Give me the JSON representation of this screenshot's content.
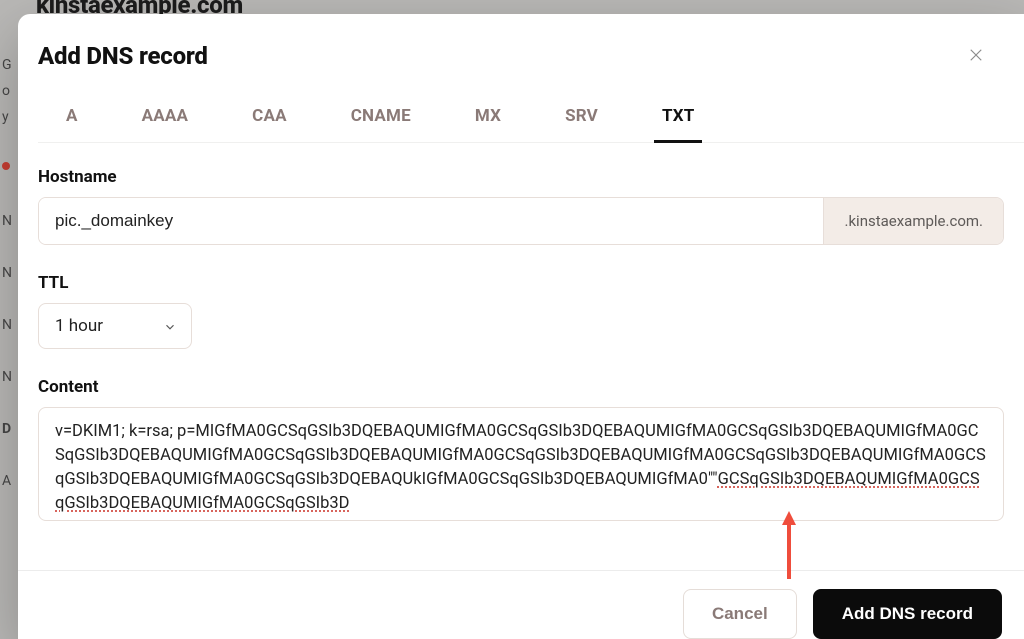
{
  "underlying": {
    "domain_text": "kinstaexample.com",
    "left_gutter": [
      "G",
      "o",
      "y",
      " ",
      "●",
      " ",
      "N",
      " ",
      "N",
      " ",
      "N",
      " ",
      "N",
      " ",
      "D",
      " ",
      "A"
    ]
  },
  "modal": {
    "title": "Add DNS record",
    "close_icon": "close-icon"
  },
  "tabs": [
    {
      "label": "A",
      "active": false
    },
    {
      "label": "AAAA",
      "active": false
    },
    {
      "label": "CAA",
      "active": false
    },
    {
      "label": "CNAME",
      "active": false
    },
    {
      "label": "MX",
      "active": false
    },
    {
      "label": "SRV",
      "active": false
    },
    {
      "label": "TXT",
      "active": true
    }
  ],
  "hostname": {
    "label": "Hostname",
    "value": "pic._domainkey",
    "suffix": ".kinstaexample.com."
  },
  "ttl": {
    "label": "TTL",
    "selected": "1 hour"
  },
  "content": {
    "label": "Content",
    "value_head": "v=DKIM1; k=rsa; p=MIGfMA0GCSqGSIb3DQEBAQUMIGfMA0GCSqGSIb3DQEBAQUMIGfMA0GCSqGSIb3DQEBAQUMIGfMA0GCSqGSIb3DQEBAQUMIGfMA0GCSqGSIb3DQEBAQUMIGfMA0GCSqGSIb3DQEBAQUMIGfMA0GCSqGSIb3DQEBAQUMIGfMA0GCSqGSIb3DQEBAQUMIGfMA0GCSqGSIb3DQEBAQUkIGfMA0GCSqGSIb3DQEBAQUMIGfMA0\"\"",
    "value_tail_underlined": "GCSqGSIb3DQEBAQUMIGfMA0GCSqGSIb3DQEBAQUMIGfMA0GCSqGSIb3D"
  },
  "footer": {
    "cancel": "Cancel",
    "submit": "Add DNS record"
  },
  "annotation": {
    "arrow_color": "#ef4d3c"
  }
}
